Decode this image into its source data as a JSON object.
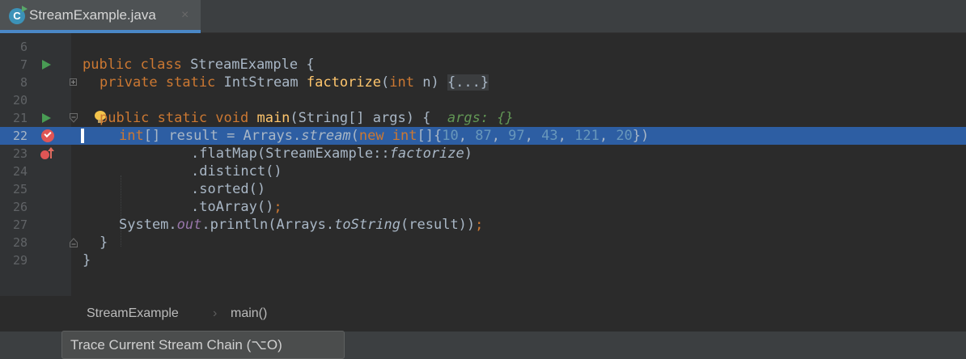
{
  "tab": {
    "filename": "StreamExample.java",
    "icon": "java-class-icon",
    "icon_letter": "C",
    "close_glyph": "×"
  },
  "editor": {
    "line_numbers": [
      "6",
      "7",
      "8",
      "20",
      "21",
      "22",
      "23",
      "24",
      "25",
      "26",
      "27",
      "28",
      "29"
    ],
    "lines": {
      "l7": {
        "kw": "public class ",
        "name": "StreamExample {"
      },
      "l8": {
        "kw": "private static ",
        "type": "IntStream ",
        "fn": "factorize",
        "p1": "(",
        "kw2": "int ",
        "p2": "n) ",
        "fold": "{...}"
      },
      "l21": {
        "kw": "public static void ",
        "fn": "main",
        "rest": "(String[] args) {  ",
        "hint": "args: {}"
      },
      "l22": {
        "kw": "int",
        "a": "[] result = Arrays.",
        "it": "stream",
        "b": "(",
        "kw2": "new int",
        "c": "[]{",
        "n1": "10",
        "n2": "87",
        "n3": "97",
        "n4": "43",
        "n5": "121",
        "n6": "20",
        "d": "})",
        "sep": ", "
      },
      "l23": {
        "a": ".flatMap(StreamExample::",
        "it": "factorize",
        "b": ")"
      },
      "l24": {
        "a": ".distinct()"
      },
      "l25": {
        "a": ".sorted()"
      },
      "l26": {
        "a": ".toArray()",
        "semi": ";"
      },
      "l27": {
        "a": "System.",
        "st": "out",
        "b": ".println(Arrays.",
        "it": "toString",
        "c": "(result))",
        "semi": ";"
      },
      "l28": {
        "a": "}"
      },
      "l29": {
        "a": "}"
      }
    },
    "highlighted_line": "22"
  },
  "breadcrumbs": {
    "items": [
      "StreamExample",
      "main()"
    ],
    "separator": "›"
  },
  "tooltip": {
    "text": "Trace Current Stream Chain (⌥O)"
  },
  "colors": {
    "keyword": "#cc7832",
    "function": "#ffc66d",
    "number": "#6897bb",
    "hint": "#629755",
    "selection": "#2d5ea3"
  }
}
